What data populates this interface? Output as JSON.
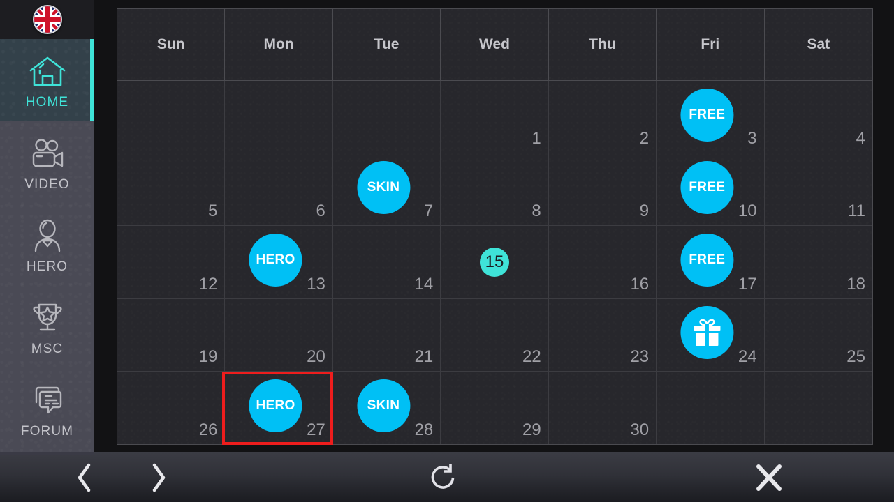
{
  "sidebar": {
    "language_flag": {
      "name": "united-kingdom-flag",
      "label": "UK"
    },
    "items": [
      {
        "label": "HOME",
        "icon": "home-icon",
        "active": true
      },
      {
        "label": "VIDEO",
        "icon": "video-camera-icon",
        "active": false
      },
      {
        "label": "HERO",
        "icon": "person-icon",
        "active": false
      },
      {
        "label": "MSC",
        "icon": "trophy-icon",
        "active": false
      },
      {
        "label": "FORUM",
        "icon": "speech-bubbles-icon",
        "active": false
      }
    ],
    "active_accent_color": "#3fe3d8"
  },
  "calendar": {
    "day_headers": [
      "Sun",
      "Mon",
      "Tue",
      "Wed",
      "Thu",
      "Fri",
      "Sat"
    ],
    "today": 15,
    "badge_color": "#00c0f5",
    "today_color": "#3fe3d8",
    "selection_color": "#ee1d1d",
    "selected_day": 27,
    "weeks": [
      [
        {
          "day": ""
        },
        {
          "day": ""
        },
        {
          "day": ""
        },
        {
          "day": "1"
        },
        {
          "day": "2"
        },
        {
          "day": "3",
          "badge": "FREE"
        },
        {
          "day": "4"
        }
      ],
      [
        {
          "day": "5"
        },
        {
          "day": "6"
        },
        {
          "day": "7",
          "badge": "SKIN"
        },
        {
          "day": "8"
        },
        {
          "day": "9"
        },
        {
          "day": "10",
          "badge": "FREE"
        },
        {
          "day": "11"
        }
      ],
      [
        {
          "day": "12"
        },
        {
          "day": "13",
          "badge": "HERO"
        },
        {
          "day": "14"
        },
        {
          "day": "15",
          "today": true
        },
        {
          "day": "16"
        },
        {
          "day": "17",
          "badge": "FREE"
        },
        {
          "day": "18"
        }
      ],
      [
        {
          "day": "19"
        },
        {
          "day": "20"
        },
        {
          "day": "21"
        },
        {
          "day": "22"
        },
        {
          "day": "23"
        },
        {
          "day": "24",
          "badge_icon": "gift-icon"
        },
        {
          "day": "25"
        }
      ],
      [
        {
          "day": "26"
        },
        {
          "day": "27",
          "badge": "HERO",
          "selected": true
        },
        {
          "day": "28",
          "badge": "SKIN"
        },
        {
          "day": "29"
        },
        {
          "day": "30"
        },
        {
          "day": ""
        },
        {
          "day": ""
        }
      ]
    ]
  },
  "bottombar": {
    "prev_label": "Back",
    "next_label": "Forward",
    "refresh_label": "Refresh",
    "close_label": "Close"
  }
}
